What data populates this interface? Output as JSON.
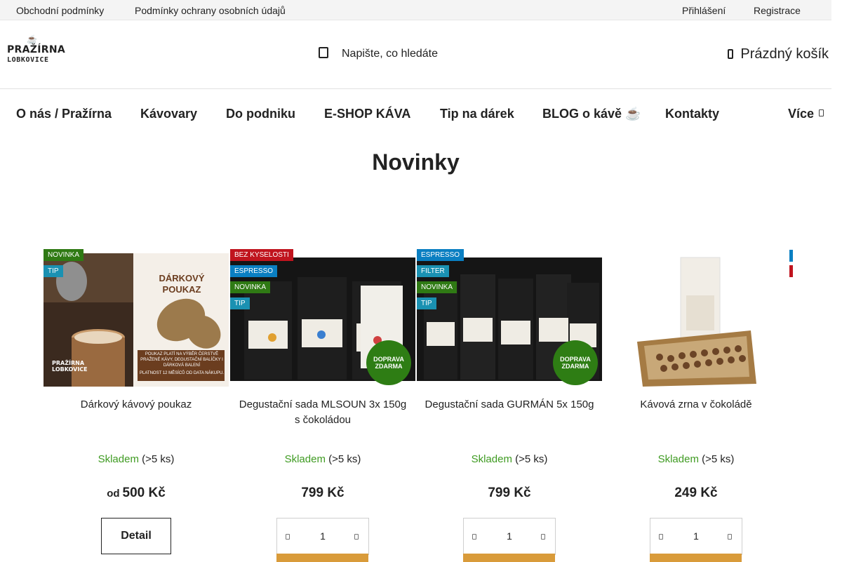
{
  "topbar": {
    "links": [
      "Obchodní podmínky",
      "Podmínky ochrany osobních údajů"
    ],
    "login": "Přihlášení",
    "register": "Registrace"
  },
  "header": {
    "logo_line1": "PRAŽÍRNA",
    "logo_line2": "LOBKOVICE",
    "search_placeholder": "Napište, co hledáte",
    "cart_label": "Prázdný košík"
  },
  "nav": {
    "items": [
      "O nás / Pražírna",
      "Kávovary",
      "Do podniku",
      "E-SHOP KÁVA",
      "Tip na dárek",
      "BLOG o kávě ☕",
      "Kontakty"
    ],
    "more": "Více"
  },
  "main": {
    "title": "Novinky"
  },
  "colors": {
    "novinka": "#2f7a14",
    "tip": "#1a91b2",
    "espresso": "#0a7fc2",
    "filter": "#1a91b2",
    "bez_kyselosti": "#c0141e",
    "free_shipping": "#2e7d14",
    "stock": "#3f9b22",
    "buy": "#d99b3a"
  },
  "products": [
    {
      "name": "Dárkový kávový poukaz",
      "flags": [
        "NOVINKA",
        "TIP"
      ],
      "stock": "Skladem",
      "stock_detail": "(>5 ks)",
      "price_prefix": "od",
      "price": "500 Kč",
      "action": "Detail",
      "voucher_title": "DÁRKOVÝ POUKAZ",
      "voucher_text": "POUKAZ PLATÍ NA VÝBĚR ČERSTVĚ PRAŽENÉ KÁVY, DEGUSTAČNÍ BALÍČKY I DÁRKOVÁ BALENÍ",
      "voucher_validity": "PLATNOST 12 MĚSÍCŮ OD DATA NÁKUPU."
    },
    {
      "name": "Degustační sada MLSOUN 3x 150g s čokoládou",
      "flags": [
        "BEZ KYSELOSTI",
        "ESPRESSO",
        "NOVINKA",
        "TIP"
      ],
      "free_shipping": "DOPRAVA ZDARMA",
      "stock": "Skladem",
      "stock_detail": "(>5 ks)",
      "price": "799 Kč",
      "qty": "1"
    },
    {
      "name": "Degustační sada GURMÁN 5x 150g",
      "flags": [
        "ESPRESSO",
        "FILTER",
        "NOVINKA",
        "TIP"
      ],
      "free_shipping": "DOPRAVA ZDARMA",
      "stock": "Skladem",
      "stock_detail": "(>5 ks)",
      "price": "799 Kč",
      "qty": "1"
    },
    {
      "name": "Kávová zrna v čokoládě",
      "flags": [],
      "stock": "Skladem",
      "stock_detail": "(>5 ks)",
      "price": "249 Kč",
      "qty": "1"
    }
  ]
}
